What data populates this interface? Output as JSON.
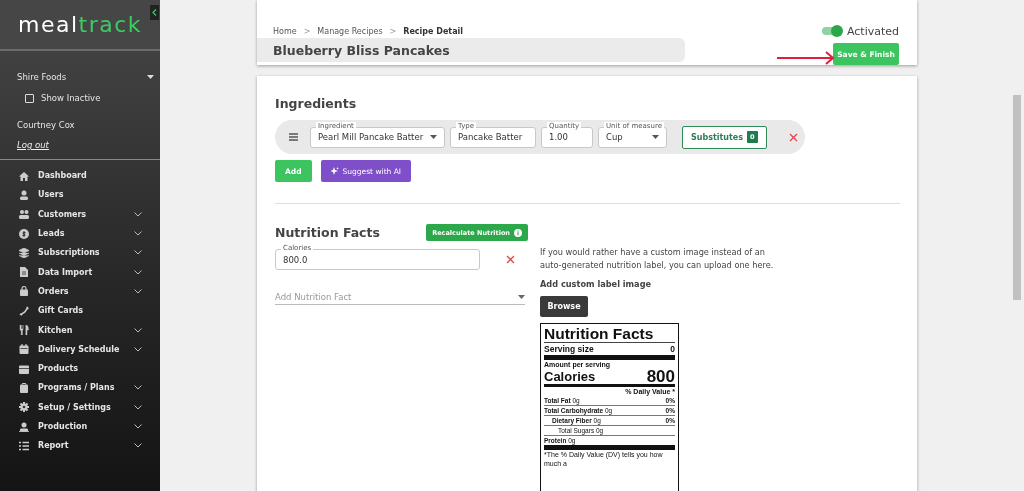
{
  "sidebar": {
    "logo": {
      "first": "meal",
      "second": "track"
    },
    "organization": "Shire Foods",
    "show_inactive": {
      "label": "Show Inactive",
      "checked": false
    },
    "user_name": "Courtney Cox",
    "logout": "Log out",
    "nav_items": [
      {
        "label": "Dashboard",
        "expandable": false
      },
      {
        "label": "Users",
        "expandable": false
      },
      {
        "label": "Customers",
        "expandable": true
      },
      {
        "label": "Leads",
        "expandable": true
      },
      {
        "label": "Subscriptions",
        "expandable": true
      },
      {
        "label": "Data Import",
        "expandable": true
      },
      {
        "label": "Orders",
        "expandable": true
      },
      {
        "label": "Gift Cards",
        "expandable": false
      },
      {
        "label": "Kitchen",
        "expandable": true
      },
      {
        "label": "Delivery Schedule",
        "expandable": true
      },
      {
        "label": "Products",
        "expandable": false
      },
      {
        "label": "Programs / Plans",
        "expandable": true
      },
      {
        "label": "Setup / Settings",
        "expandable": true
      },
      {
        "label": "Production",
        "expandable": true
      },
      {
        "label": "Report",
        "expandable": true
      }
    ]
  },
  "header": {
    "breadcrumbs": [
      {
        "label": "Home",
        "current": false
      },
      {
        "separator": ">",
        "label": "Manage Recipes",
        "current": false
      },
      {
        "separator": ">",
        "label": "Recipe Detail",
        "current": true
      }
    ],
    "title": "Blueberry Bliss Pancakes",
    "activated": {
      "label": "Activated",
      "on": true
    },
    "save_button": "Save & Finish"
  },
  "ingredients": {
    "heading": "Ingredients",
    "rows": [
      {
        "ingredient": {
          "label": "Ingredient",
          "value": "Pearl Mill Pancake Batter"
        },
        "type": {
          "label": "Type",
          "value": "Pancake Batter"
        },
        "quantity": {
          "label": "Quantity",
          "value": "1.00"
        },
        "unit": {
          "label": "Unit of measure",
          "value": "Cup"
        },
        "substitutes": {
          "label": "Substitutes",
          "count": "0"
        }
      }
    ],
    "add_button": "Add",
    "suggest_button": "Suggest with AI"
  },
  "nutrition": {
    "heading": "Nutrition Facts",
    "recalculate_button": "Recalculate Nutrition",
    "facts": [
      {
        "label": "Calories",
        "value": "800.0"
      }
    ],
    "add_fact": {
      "placeholder": "Add Nutrition Fact"
    },
    "custom_image_hint": "If you would rather have a custom image instead of an auto-generated nutrition label, you can upload one here.",
    "custom_label_heading": "Add custom label image",
    "browse_button": "Browse",
    "label": {
      "title": "Nutrition Facts",
      "serving_label": "Serving size",
      "serving_value": "0",
      "amount_per_serving": "Amount per serving",
      "calories_label": "Calories",
      "calories_value": "800",
      "daily_value_heading": "% Daily Value *",
      "rows": [
        {
          "kind": "main",
          "name": "Total Fat",
          "amount": "0g",
          "percent": "0%"
        },
        {
          "kind": "main",
          "name": "Total Carbohydrate",
          "amount": "0g",
          "percent": "0%"
        },
        {
          "kind": "sub",
          "name": "Dietary Fiber",
          "amount": "0g",
          "percent": "0%"
        },
        {
          "kind": "subsub",
          "name": "Total Sugars",
          "amount": "0g"
        },
        {
          "kind": "main",
          "name": "Protein",
          "amount": "0g"
        }
      ],
      "footnote": "*The % Daily Value (DV) tells you how much a"
    }
  }
}
